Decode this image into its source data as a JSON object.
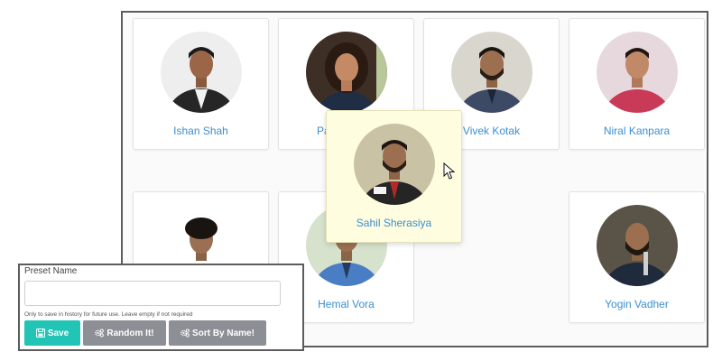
{
  "board": {
    "cards": [
      {
        "name": "Ishan Shah"
      },
      {
        "name": "Pa"
      },
      {
        "name": "Vivek Kotak"
      },
      {
        "name": "Niral Kanpara"
      },
      {
        "name": ""
      },
      {
        "name": "Hemal Vora"
      },
      {
        "name": "Yogin Vadher"
      }
    ],
    "dragging_card": {
      "name": "Sahil Sherasiya"
    }
  },
  "preset_panel": {
    "label": "Preset Name",
    "input_value": "",
    "input_placeholder": "",
    "hint": "Only to save in history for future use. Leave empty if not required",
    "buttons": {
      "save": {
        "label": "Save",
        "icon": "save-icon",
        "color": "#22c5b5"
      },
      "random": {
        "label": "Random It!",
        "icon": "gears-icon",
        "color": "#8c8f96"
      },
      "sort": {
        "label": "Sort By Name!",
        "icon": "gears-icon",
        "color": "#8c8f96"
      }
    }
  },
  "colors": {
    "name_text": "#3a8fd0",
    "dragging_card_bg": "#fffde0"
  }
}
